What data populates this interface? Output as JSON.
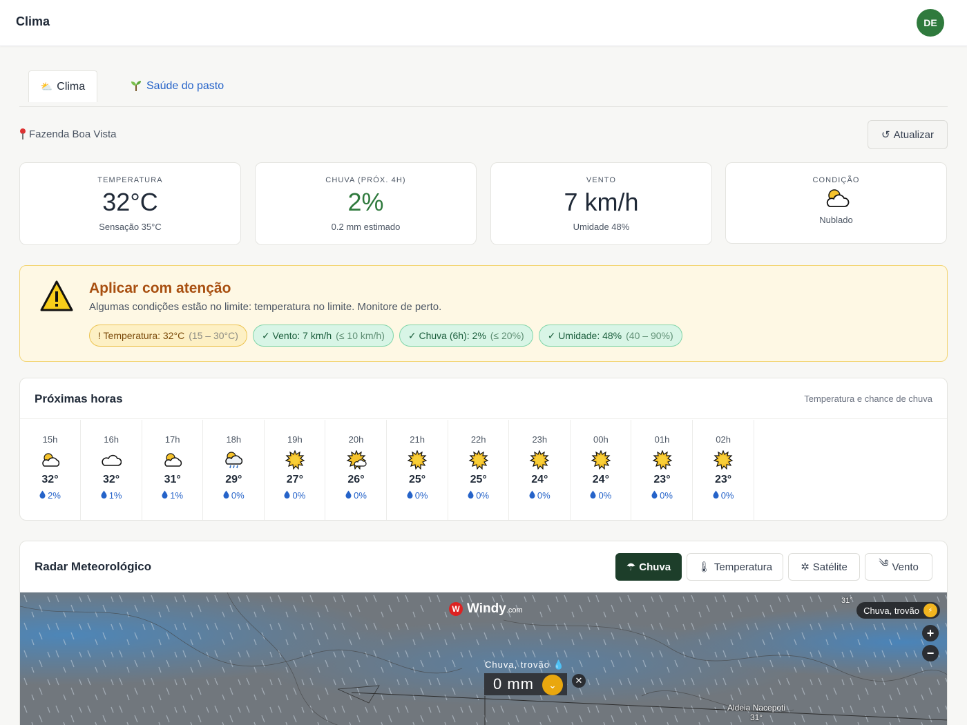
{
  "app": {
    "title": "Clima",
    "user_initials": "DE"
  },
  "tabs": [
    {
      "label": "Clima",
      "icon": "sun-behind-cloud-icon",
      "active": true
    },
    {
      "label": "Saúde do pasto",
      "icon": "seedling-icon",
      "active": false
    }
  ],
  "location": {
    "name": "Fazenda Boa Vista",
    "icon": "pin-icon"
  },
  "actions": {
    "refresh_label": "Atualizar"
  },
  "kpis": {
    "temperature": {
      "label": "TEMPERATURA",
      "value": "32°C",
      "sub": "Sensação 35°C"
    },
    "rain": {
      "label": "CHUVA (PRÓX. 4H)",
      "value": "2%",
      "sub": "0.2 mm estimado"
    },
    "wind": {
      "label": "VENTO",
      "value": "7 km/h",
      "sub": "Umidade 48%"
    },
    "condition": {
      "label": "CONDIÇÃO",
      "icon": "sun-behind-cloud-icon",
      "sub": "Nublado"
    }
  },
  "alert": {
    "title": "Aplicar com atenção",
    "message": "Algumas condições estão no limite: temperatura no limite. Monitore de perto.",
    "chips": [
      {
        "text": "! Temperatura: 32°C",
        "limit": "(15 – 30°C)",
        "status": "warn"
      },
      {
        "text": "✓ Vento: 7 km/h",
        "limit": "(≤ 10 km/h)",
        "status": "ok"
      },
      {
        "text": "✓ Chuva (6h): 2%",
        "limit": "(≤ 20%)",
        "status": "ok"
      },
      {
        "text": "✓ Umidade: 48%",
        "limit": "(40 – 90%)",
        "status": "ok"
      }
    ]
  },
  "hourly": {
    "title": "Próximas horas",
    "subtitle": "Temperatura e chance de chuva",
    "hours": [
      {
        "time": "15h",
        "icon": "sun-behind-cloud",
        "temp": "32°",
        "rain": "2%"
      },
      {
        "time": "16h",
        "icon": "cloud",
        "temp": "32°",
        "rain": "1%"
      },
      {
        "time": "17h",
        "icon": "sun-behind-cloud",
        "temp": "31°",
        "rain": "1%"
      },
      {
        "time": "18h",
        "icon": "sun-behind-rain-cloud",
        "temp": "29°",
        "rain": "0%"
      },
      {
        "time": "19h",
        "icon": "sun",
        "temp": "27°",
        "rain": "0%"
      },
      {
        "time": "20h",
        "icon": "sun-small-cloud",
        "temp": "26°",
        "rain": "0%"
      },
      {
        "time": "21h",
        "icon": "sun",
        "temp": "25°",
        "rain": "0%"
      },
      {
        "time": "22h",
        "icon": "sun",
        "temp": "25°",
        "rain": "0%"
      },
      {
        "time": "23h",
        "icon": "sun",
        "temp": "24°",
        "rain": "0%"
      },
      {
        "time": "00h",
        "icon": "sun",
        "temp": "24°",
        "rain": "0%"
      },
      {
        "time": "01h",
        "icon": "sun",
        "temp": "23°",
        "rain": "0%"
      },
      {
        "time": "02h",
        "icon": "sun",
        "temp": "23°",
        "rain": "0%"
      }
    ]
  },
  "radar": {
    "title": "Radar Meteorológico",
    "layers": [
      {
        "label": "Chuva",
        "icon": "umbrella-rain-icon",
        "active": true
      },
      {
        "label": "Temperatura",
        "icon": "thermometer-icon",
        "active": false
      },
      {
        "label": "Satélite",
        "icon": "satellite-icon",
        "active": false
      },
      {
        "label": "Vento",
        "icon": "wind-icon",
        "active": false
      }
    ],
    "map": {
      "brand": "Windy",
      "brand_suffix": ".com",
      "top_tooltip": "Chuva, trovão",
      "top_temp": "31°",
      "probe_label": "Chuva, trovão",
      "probe_value": "0 mm",
      "place_name": "Aldeia Nacepoti",
      "place_temp": "31°"
    }
  },
  "colors": {
    "accent_green": "#2f7a3d",
    "link_blue": "#2563c9",
    "alert_title": "#a84f10",
    "radar_active": "#1d3e2a"
  }
}
